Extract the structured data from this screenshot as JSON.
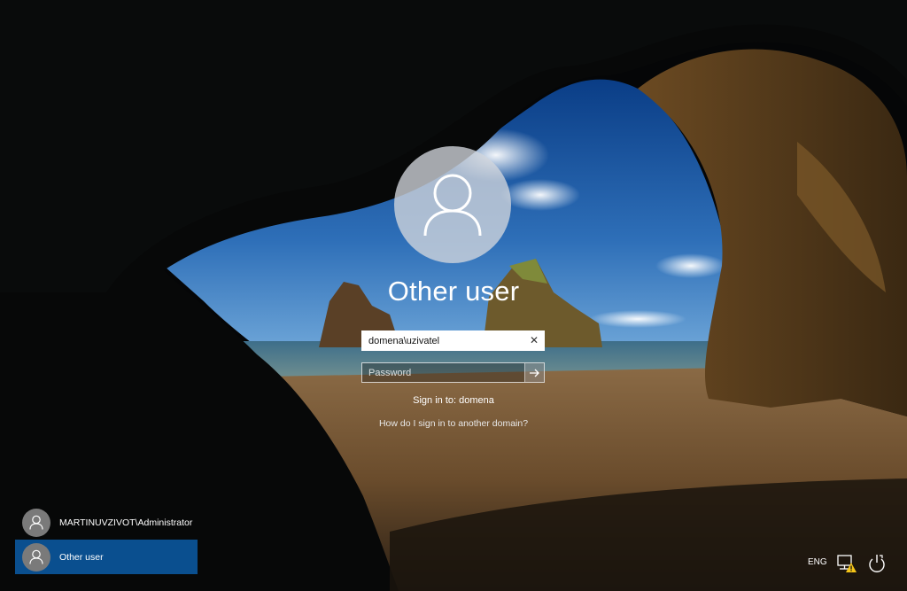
{
  "login": {
    "title": "Other user",
    "username_value": "domena\\uzivatel",
    "password_placeholder": "Password",
    "clear_glyph": "✕",
    "sign_in_to": "Sign in to: domena",
    "help_link": "How do I sign in to another domain?"
  },
  "user_list": {
    "items": [
      {
        "name": "MARTINUVZIVOT\\Administrator",
        "selected": false
      },
      {
        "name": "Other user",
        "selected": true
      }
    ]
  },
  "tray": {
    "language": "ENG",
    "icons": [
      "network-warning-icon",
      "power-icon"
    ]
  },
  "colors": {
    "selection": "#0a4f8f",
    "warning": "#f5c518"
  }
}
